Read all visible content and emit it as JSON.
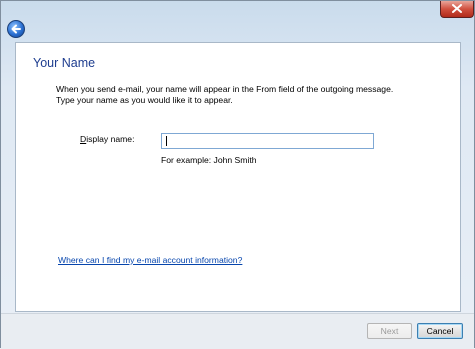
{
  "page": {
    "heading": "Your Name",
    "description": [
      "When you send e-mail, your name will appear in the From field of the outgoing message.",
      "Type your name as you would like it to appear."
    ]
  },
  "form": {
    "display_name": {
      "label_access_key": "D",
      "label_rest": "isplay name:",
      "value": ""
    },
    "example_text": "For example: John Smith"
  },
  "help_link": "Where can I find my e-mail account information?",
  "footer": {
    "next_label": "Next",
    "cancel_label_access_key": "",
    "cancel_label": "Cancel"
  },
  "icons": {
    "back": "back-arrow-icon",
    "close": "close-icon"
  }
}
